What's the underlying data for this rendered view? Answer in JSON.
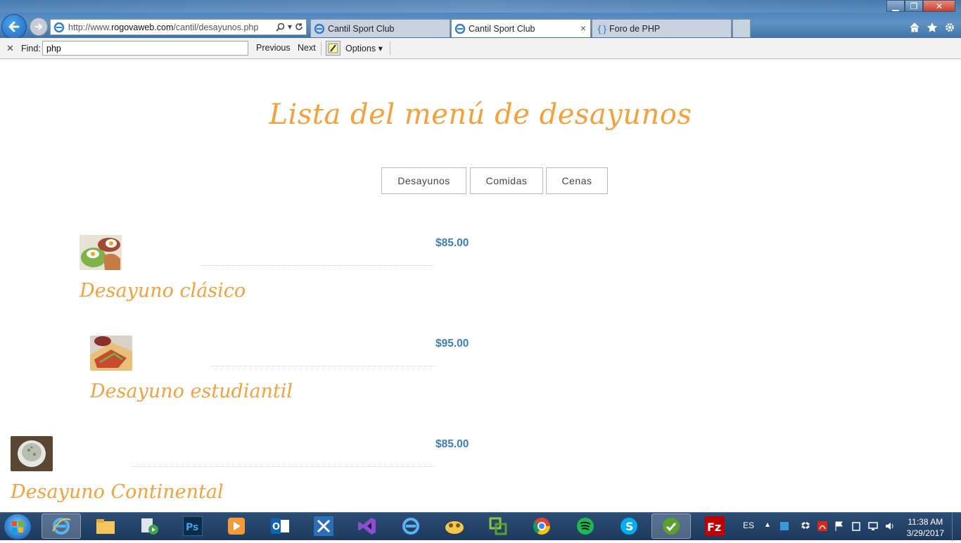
{
  "browser": {
    "url_prefix": "http://www.",
    "url_domain": "rogovaweb.com",
    "url_path": "/cantil/desayunos.php",
    "tabs": [
      {
        "label": "Cantil Sport Club"
      },
      {
        "label": "Cantil Sport Club"
      },
      {
        "label": "Foro de PHP"
      }
    ],
    "close_tab_glyph": "×"
  },
  "findbar": {
    "label": "Find:",
    "query": "php",
    "previous": "Previous",
    "next": "Next",
    "options": "Options"
  },
  "page": {
    "title": "Lista del menú de desayunos",
    "categories": [
      "Desayunos",
      "Comidas",
      "Cenas"
    ],
    "items": [
      {
        "name": "Desayuno clásico",
        "price": "$85.00",
        "image": "eggs-breakfast-image"
      },
      {
        "name": "Desayuno estudiantil",
        "price": "$95.00",
        "image": "quesadilla-image"
      },
      {
        "name": "Desayuno Continental",
        "price": "$85.00",
        "image": "bowl-image"
      }
    ]
  },
  "taskbar": {
    "language": "ES",
    "time": "11:38 AM",
    "date": "3/29/2017",
    "apps": [
      "internet-explorer",
      "file-explorer",
      "media-center",
      "photoshop",
      "media-player",
      "outlook",
      "tools",
      "visual-studio",
      "internet-explorer-2",
      "cloud-app",
      "vmware",
      "chrome",
      "spotify",
      "skype",
      "dreamweaver",
      "filezilla"
    ]
  },
  "colors": {
    "accent_orange": "#f5a03a",
    "price_blue": "#3a7dc3",
    "taskbar": "#1d3a5e"
  }
}
